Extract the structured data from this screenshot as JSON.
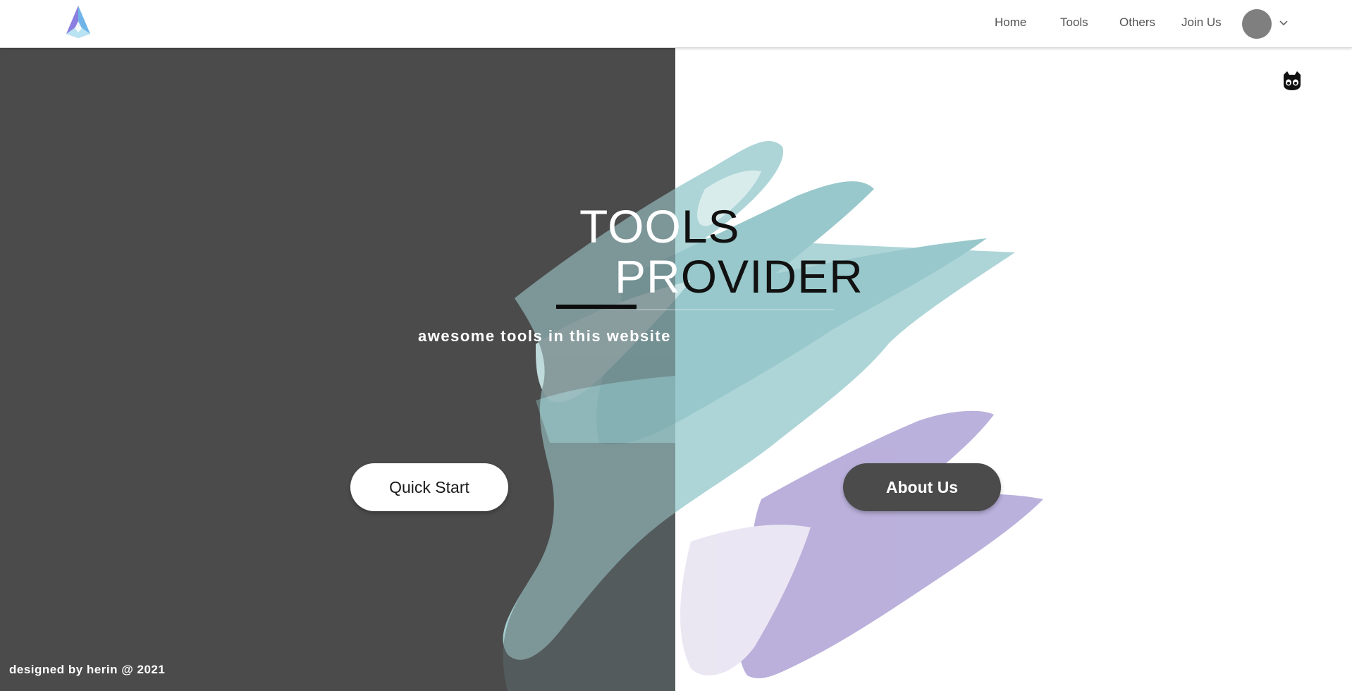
{
  "nav": {
    "items": [
      "Home",
      "Tools",
      "Others",
      "Join Us"
    ]
  },
  "hero": {
    "title_line1": "TOOLS",
    "title_line2": "PROVIDER",
    "subtitle": "awesome tools in this website",
    "quick_start_label": "Quick Start",
    "about_us_label": "About Us"
  },
  "footer": {
    "credit": "designed by herin @ 2021"
  },
  "icons": {
    "logo": "logo-icon",
    "avatar": "avatar",
    "dropdown": "chevron-down-icon",
    "github": "github-icon"
  },
  "colors": {
    "dark_panel": "#4b4b4b",
    "teal_paint": "#8fc5c7",
    "lavender_paint": "#a79ad0"
  }
}
